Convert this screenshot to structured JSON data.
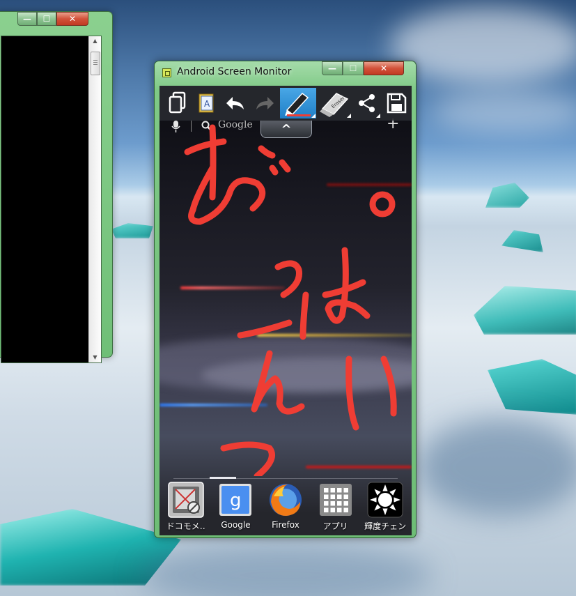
{
  "left_window": {
    "controls": {
      "minimize": "—",
      "maximize": "☐",
      "close": "✕"
    },
    "scroll_up_arrow": "▲",
    "scroll_down_arrow": "▼"
  },
  "main_window": {
    "title": "Android Screen Monitor",
    "controls": {
      "minimize": "—",
      "maximize": "☐",
      "close": "✕"
    },
    "toolbar": [
      {
        "name": "copy-icon"
      },
      {
        "name": "text-input-icon",
        "label": "A"
      },
      {
        "name": "undo-icon"
      },
      {
        "name": "redo-icon"
      },
      {
        "name": "pen-icon",
        "active": true
      },
      {
        "name": "eraser-icon",
        "label": "Eraser"
      },
      {
        "name": "share-icon"
      },
      {
        "name": "save-icon"
      }
    ],
    "search": {
      "label": "Google",
      "plus": "+"
    },
    "pull_tab_symbol": "^",
    "drawing_color": "#ef3d34",
    "dock": [
      {
        "label": "ドコモメ‥",
        "icon": "docomo-mail-icon"
      },
      {
        "label": "Google",
        "icon": "google-icon",
        "glyph": "g"
      },
      {
        "label": "Firefox",
        "icon": "firefox-icon"
      },
      {
        "label": "アプリ",
        "icon": "apps-grid-icon"
      },
      {
        "label": "輝度チェン",
        "icon": "brightness-icon"
      }
    ]
  }
}
